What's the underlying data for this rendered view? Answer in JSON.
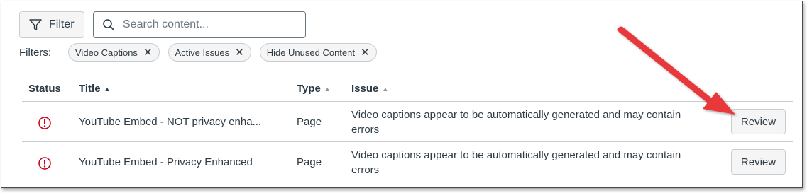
{
  "toolbar": {
    "filter_label": "Filter",
    "search_placeholder": "Search content..."
  },
  "filters": {
    "label": "Filters:",
    "chips": [
      "Video Captions",
      "Active Issues",
      "Hide Unused Content"
    ]
  },
  "table": {
    "headers": {
      "status": "Status",
      "title": "Title",
      "type": "Type",
      "issue": "Issue"
    },
    "rows": [
      {
        "title": "YouTube Embed - NOT privacy enha...",
        "type": "Page",
        "issue_line1": "Video captions appear to be automatically generated and may contain",
        "issue_line2": "errors",
        "action": "Review"
      },
      {
        "title": "YouTube Embed - Privacy Enhanced",
        "type": "Page",
        "issue_line1": "Video captions appear to be automatically generated and may contain",
        "issue_line2": "errors",
        "action": "Review"
      }
    ]
  },
  "colors": {
    "error": "#d0021b",
    "arrow": "#e8373a"
  },
  "icons": {
    "filter": "funnel-icon",
    "search": "search-icon",
    "status": "error-icon",
    "chip_remove": "close-icon"
  }
}
